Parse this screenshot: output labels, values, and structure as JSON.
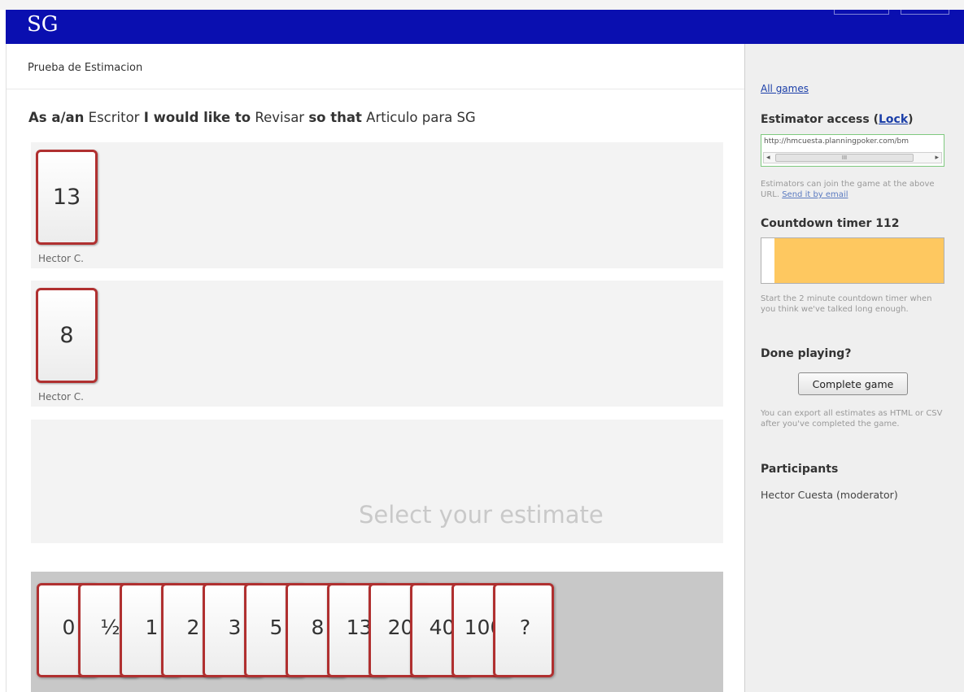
{
  "header": {
    "logo": "SG"
  },
  "game": {
    "title": "Prueba de Estimacion"
  },
  "story": {
    "prefix1": "As a/an",
    "role": "Escritor",
    "prefix2": "I would like to",
    "goal": "Revisar",
    "prefix3": "so that",
    "benefit": "Articulo para SG"
  },
  "estimates": [
    {
      "value": "13",
      "name": "Hector C."
    },
    {
      "value": "8",
      "name": "Hector C."
    }
  ],
  "select_prompt": "Select your estimate",
  "deck": {
    "cards": [
      "0",
      "½",
      "1",
      "2",
      "3",
      "5",
      "8",
      "13",
      "20",
      "40",
      "100",
      "?"
    ]
  },
  "sidebar": {
    "all_games": "All games",
    "estimator_access": {
      "heading": "Estimator access",
      "lock_paren_open": "(",
      "lock_label": "Lock",
      "lock_paren_close": ")"
    },
    "url": "http://hmcuesta.planningpoker.com/bm",
    "scroll": {
      "left": "◂",
      "thumb": "III",
      "right": "▸"
    },
    "access_hint": {
      "text": "Estimators can join the game at the above URL. ",
      "link": "Send it by email"
    },
    "countdown": {
      "heading": "Countdown timer 112",
      "remaining_fraction": 0.93
    },
    "countdown_hint": "Start the 2 minute countdown timer when you think we've talked long enough.",
    "done": {
      "heading": "Done playing?",
      "button": "Complete game"
    },
    "export_hint": "You can export all estimates as HTML or CSV after you've completed the game.",
    "participants": {
      "heading": "Participants",
      "items": [
        "Hector Cuesta (moderator)"
      ]
    }
  }
}
